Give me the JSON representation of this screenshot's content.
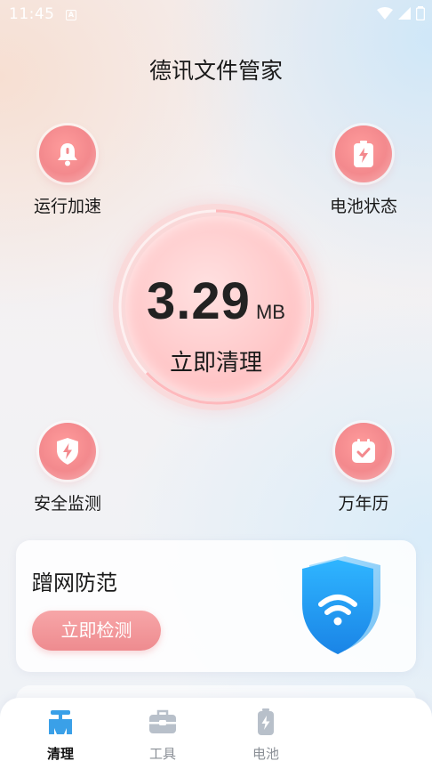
{
  "status_bar": {
    "time": "11:45",
    "notification_letter": "A"
  },
  "app": {
    "title": "德讯文件管家"
  },
  "features": {
    "run_speed": {
      "label": "运行加速",
      "icon": "bell-icon"
    },
    "battery_status": {
      "label": "电池状态",
      "icon": "battery-icon"
    },
    "security_monitor": {
      "label": "安全监测",
      "icon": "shield-bolt-icon"
    },
    "calendar": {
      "label": "万年历",
      "icon": "calendar-check-icon"
    }
  },
  "clean": {
    "size": "3.29",
    "unit": "MB",
    "action_label": "立即清理"
  },
  "wifi_card": {
    "title": "蹭网防范",
    "button_label": "立即检测",
    "icon": "wifi-shield-icon"
  },
  "bottom_nav": {
    "clean": {
      "label": "清理",
      "icon": "broom-icon",
      "active": true
    },
    "tools": {
      "label": "工具",
      "icon": "toolbox-icon",
      "active": false
    },
    "battery": {
      "label": "电池",
      "icon": "battery-icon",
      "active": false
    }
  },
  "colors": {
    "accent": "#f08a8e",
    "nav_active": "#3aa0e8",
    "nav_inactive": "#b8c0ca"
  }
}
